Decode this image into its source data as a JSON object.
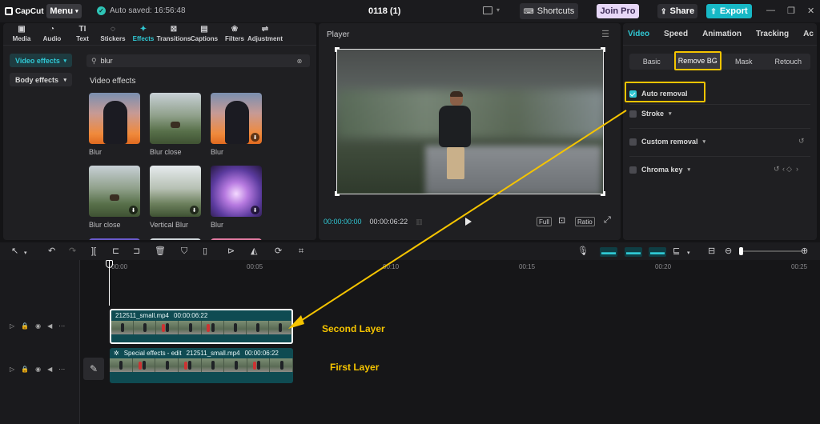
{
  "app": {
    "logo_text": "CapCut",
    "menu_label": "Menu",
    "autosave_text": "Auto saved: 16:56:48",
    "project_title": "0118 (1)",
    "shortcuts_label": "Shortcuts",
    "joinpro_label": "Join Pro",
    "share_label": "Share",
    "export_label": "Export"
  },
  "toolbar_tabs": [
    {
      "label": "Media",
      "icon": "media-icon",
      "glyph": "▣"
    },
    {
      "label": "Audio",
      "icon": "audio-icon",
      "glyph": "◔"
    },
    {
      "label": "Text",
      "icon": "text-icon",
      "glyph": "TI"
    },
    {
      "label": "Stickers",
      "icon": "stickers-icon",
      "glyph": "◌"
    },
    {
      "label": "Effects",
      "icon": "effects-icon",
      "glyph": "✦"
    },
    {
      "label": "Transitions",
      "icon": "transitions-icon",
      "glyph": "⊠"
    },
    {
      "label": "Captions",
      "icon": "captions-icon",
      "glyph": "▤"
    },
    {
      "label": "Filters",
      "icon": "filters-icon",
      "glyph": "❀"
    },
    {
      "label": "Adjustment",
      "icon": "adjustment-icon",
      "glyph": "⇌"
    }
  ],
  "effects_panel": {
    "video_effects_btn": "Video effects",
    "body_effects_btn": "Body effects",
    "search_value": "blur",
    "section_title": "Video effects",
    "items": [
      {
        "label": "Blur"
      },
      {
        "label": "Blur close"
      },
      {
        "label": "Blur"
      },
      {
        "label": "Blur close"
      },
      {
        "label": "Vertical Blur"
      },
      {
        "label": "Blur"
      }
    ]
  },
  "player": {
    "title": "Player",
    "current_time": "00:00:00:00",
    "total_time": "00:00:06:22",
    "full_label": "Full",
    "ratio_label": "Ratio"
  },
  "inspector": {
    "tabs": [
      "Video",
      "Speed",
      "Animation",
      "Tracking",
      "Ac"
    ],
    "subtabs": [
      "Basic",
      "Remove BG",
      "Mask",
      "Retouch"
    ],
    "auto_removal": "Auto removal",
    "stroke": "Stroke",
    "custom_removal": "Custom removal",
    "chroma_key": "Chroma key"
  },
  "timeline": {
    "ruler_labels": [
      "00:00",
      "00:05",
      "00:10",
      "00:15",
      "00:20",
      "00:25"
    ],
    "clip_top": {
      "name": "212511_small.mp4",
      "duration": "00:00:06:22"
    },
    "clip_bottom": {
      "prefix": "Special effects - edit",
      "name": "212511_small.mp4",
      "duration": "00:00:06:22"
    }
  },
  "annotations": {
    "second_layer": "Second Layer",
    "first_layer": "First Layer",
    "highlight_color": "#f5c400"
  }
}
